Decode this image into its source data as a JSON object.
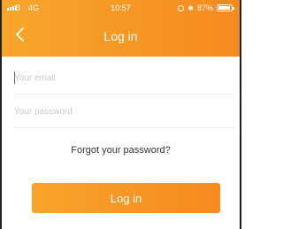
{
  "status_bar": {
    "carrier": "3",
    "network": "4G",
    "time": "10:57",
    "battery_text": "87%"
  },
  "header": {
    "title": "Log in",
    "back_icon": "chevron-left-icon",
    "gradient": [
      "#f7a62c",
      "#f68a1e"
    ]
  },
  "form": {
    "email_placeholder": "Your email",
    "password_placeholder": "Your password",
    "email_value": "",
    "password_value": ""
  },
  "links": {
    "forgot_password": "Forgot your password?"
  },
  "actions": {
    "login_label": "Log in",
    "button_color": "#f68a1e"
  }
}
